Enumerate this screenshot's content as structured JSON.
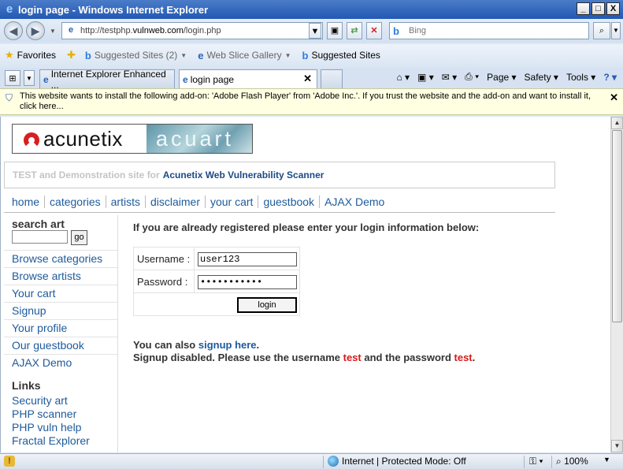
{
  "window": {
    "title": "login page - Windows Internet Explorer",
    "minimize": "_",
    "maximize": "□",
    "close": "X"
  },
  "address_bar": {
    "url_prefix": "http://testphp.",
    "url_domain": "vulnweb.com",
    "url_suffix": "/login.php",
    "search_placeholder": "Bing"
  },
  "favorites_bar": {
    "favorites_label": "Favorites",
    "suggested_sites_count": "Suggested Sites (2)",
    "web_slice_gallery": "Web Slice Gallery",
    "suggested_sites": "Suggested Sites"
  },
  "tabs": [
    {
      "label": "Internet Explorer Enhanced ..."
    },
    {
      "label": "login page"
    }
  ],
  "command_bar": {
    "page": "Page",
    "safety": "Safety",
    "tools": "Tools"
  },
  "info_bar": {
    "message": "This website wants to install the following add-on: 'Adobe Flash Player' from 'Adobe Inc.'. If you trust the website and the add-on and want to install it, click here..."
  },
  "site": {
    "logo_left": "acunetix",
    "logo_right": "acuart",
    "tagline_grey": "TEST and Demonstration site for",
    "tagline_link": "Acunetix Web Vulnerability Scanner",
    "menu": [
      "home",
      "categories",
      "artists",
      "disclaimer",
      "your cart",
      "guestbook",
      "AJAX Demo"
    ],
    "search_title": "search art",
    "search_go": "go",
    "sidebar_nav": [
      "Browse categories",
      "Browse artists",
      "Your cart",
      "Signup",
      "Your profile",
      "Our guestbook",
      "AJAX Demo"
    ],
    "links_title": "Links",
    "links": [
      "Security art",
      "PHP scanner",
      "PHP vuln help",
      "Fractal Explorer"
    ],
    "login_heading": "If you are already registered please enter your login information below:",
    "username_label": "Username :",
    "username_value": "user123",
    "password_label": "Password :",
    "password_value": "•••••••••••",
    "login_button": "login",
    "signup_prefix": "You can also",
    "signup_link": "signup here",
    "signup_period": ".",
    "disabled_prefix": "Signup disabled. Please use the username",
    "disabled_user": "test",
    "disabled_mid": "and the password",
    "disabled_pass": "test",
    "disabled_period": "."
  },
  "status_bar": {
    "zone": "Internet | Protected Mode: Off",
    "zoom": "100%"
  }
}
